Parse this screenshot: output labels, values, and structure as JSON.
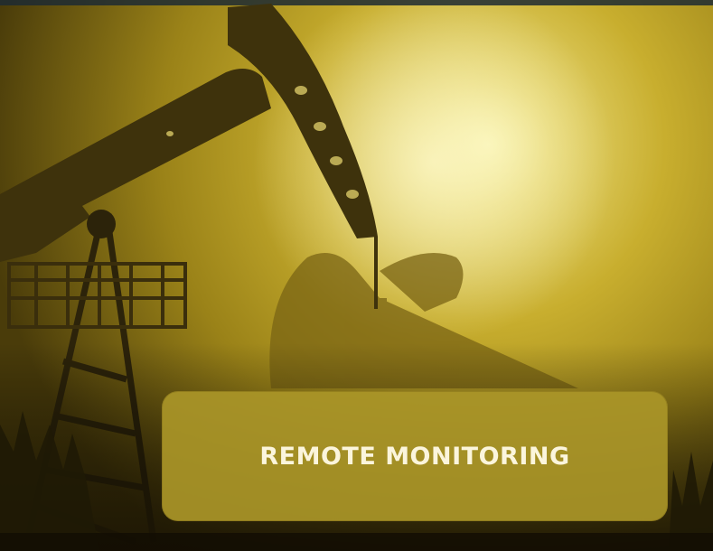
{
  "banner": {
    "label": "REMOTE MONITORING"
  },
  "colors": {
    "sky_glow": "#f4ee9c",
    "sky_mid": "#c9b02c",
    "sky_dark": "#5b4b10",
    "banner_fill": "#aa9628",
    "banner_text": "#fbf5dc",
    "silhouette": "#2a220a"
  },
  "image": {
    "subject": "pumpjack-silhouettes"
  }
}
